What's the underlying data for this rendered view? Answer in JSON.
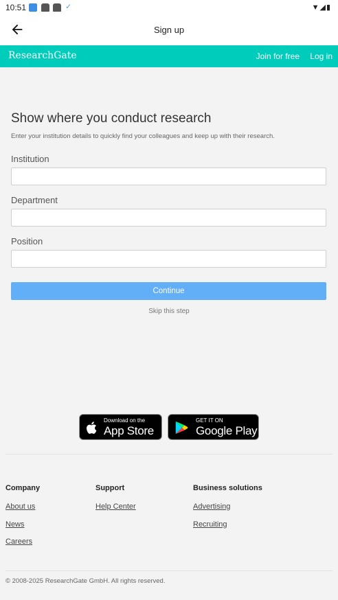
{
  "status_bar": {
    "time": "10:51"
  },
  "app_bar": {
    "title": "Sign up"
  },
  "header": {
    "logo": "ResearchGate",
    "join": "Join for free",
    "login": "Log in"
  },
  "form": {
    "heading": "Show where you conduct research",
    "subtext": "Enter your institution details to quickly find your colleagues and keep up with their research.",
    "institution_label": "Institution",
    "institution_value": "",
    "department_label": "Department",
    "department_value": "",
    "position_label": "Position",
    "position_value": "",
    "continue_label": "Continue",
    "skip_label": "Skip this step"
  },
  "stores": {
    "apple_small": "Download on the",
    "apple_big": "App Store",
    "google_small": "GET IT ON",
    "google_big": "Google Play"
  },
  "footer": {
    "company_heading": "Company",
    "company_links": [
      "About us",
      "News",
      "Careers"
    ],
    "support_heading": "Support",
    "support_links": [
      "Help Center"
    ],
    "business_heading": "Business solutions",
    "business_links": [
      "Advertising",
      "Recruiting"
    ],
    "copyright": "© 2008-2025 ResearchGate GmbH. All rights reserved."
  },
  "colors": {
    "brand": "#00ccbb",
    "button": "#62aef7",
    "background": "#f3f3f3"
  },
  "icons": [
    "back-arrow-icon",
    "apple-icon",
    "google-play-icon",
    "wifi-icon",
    "signal-icon",
    "battery-icon"
  ]
}
